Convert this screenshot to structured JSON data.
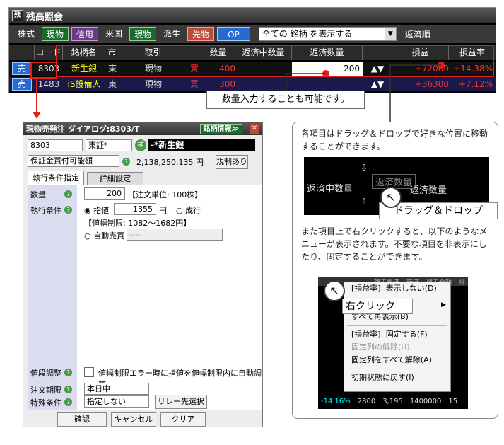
{
  "top": {
    "title": "残高照会",
    "icon": "zan-icon",
    "filters": [
      "株式",
      "現物",
      "信用",
      "米国",
      "現物",
      "派生",
      "先物",
      "OP"
    ],
    "all_select": "全ての 銘柄 を表示する",
    "sort_label": "返済順",
    "headers": [
      "",
      "コード",
      "銘柄名",
      "市",
      "取引",
      "",
      "数量",
      "返済中数量",
      "返済数量",
      "",
      "損益",
      "損益率"
    ],
    "rows": [
      {
        "btn": "売",
        "code": "8303",
        "name": "新生銀",
        "market": "東",
        "trade": "現物",
        "kind": "買",
        "qty": "400",
        "ret": "200",
        "pl": "+72000",
        "rate": "+14.38%"
      },
      {
        "btn": "売",
        "code": "1483",
        "name": "iS設備人",
        "market": "東",
        "trade": "現物",
        "kind": "買",
        "qty": "300",
        "ret": "",
        "pl": "+36300",
        "rate": "+7.12%"
      }
    ],
    "callout": "数量入力することも可能です。"
  },
  "dialog": {
    "title": "現物売発注 ダイアログ:8303/T",
    "info_btn": "銘柄情報≫",
    "code": "8303",
    "market": "東証*",
    "name": "-*新生銀",
    "account": "保証金買付可能額",
    "amount": "2,138,250,135 円",
    "limit_btn": "規制あり",
    "tabs": [
      "執行条件指定",
      "詳細設定"
    ],
    "qty_label": "数量",
    "qty": "200",
    "unit": "【注文単位: 100株】",
    "cond_label": "執行条件",
    "limit": "指値",
    "price": "1355",
    "yen": "円",
    "market_order": "成行",
    "range": "【値幅制限: 1082～1682円】",
    "auto": "自動売買",
    "auto_val": "----",
    "adjust_label": "値段調整",
    "adjust_text": "値幅制限エラー時に指値を値幅制限内に自動調整",
    "period_label": "注文期限",
    "period": "本日中",
    "special_label": "特殊条件",
    "special": "指定しない",
    "relay_btn": "リレー先選択",
    "confirm": "確認",
    "cancel": "キャンセル",
    "clear": "クリア"
  },
  "right": {
    "text1": "各項目はドラッグ＆ドロップで好きな位置に移動することができます。",
    "drag_cols": [
      "返済中数量",
      "返済数量",
      "返済数量"
    ],
    "drag_label": "ドラッグ＆ドロップ",
    "text2": "また項目上で右クリックすると、以下のようなメニューが表示されます。不要な項目を非表示にしたり、固定することができます。",
    "rclick": "右クリック",
    "menu": [
      "[損益率]: 表示しない(D)",
      "右クリック",
      "すべて再表示(B)",
      "[損益率]: 固定する(F)",
      "固定列の解除(U)",
      "固定列をすべて解除(A)",
      "初期状態に戻す(I)"
    ],
    "bg_headers": [
      "建玉単価",
      "時価",
      "建玉金額",
      "評"
    ],
    "bottom_row": [
      "-14.16%",
      "2800",
      "3,195",
      "1400000",
      "15"
    ]
  }
}
